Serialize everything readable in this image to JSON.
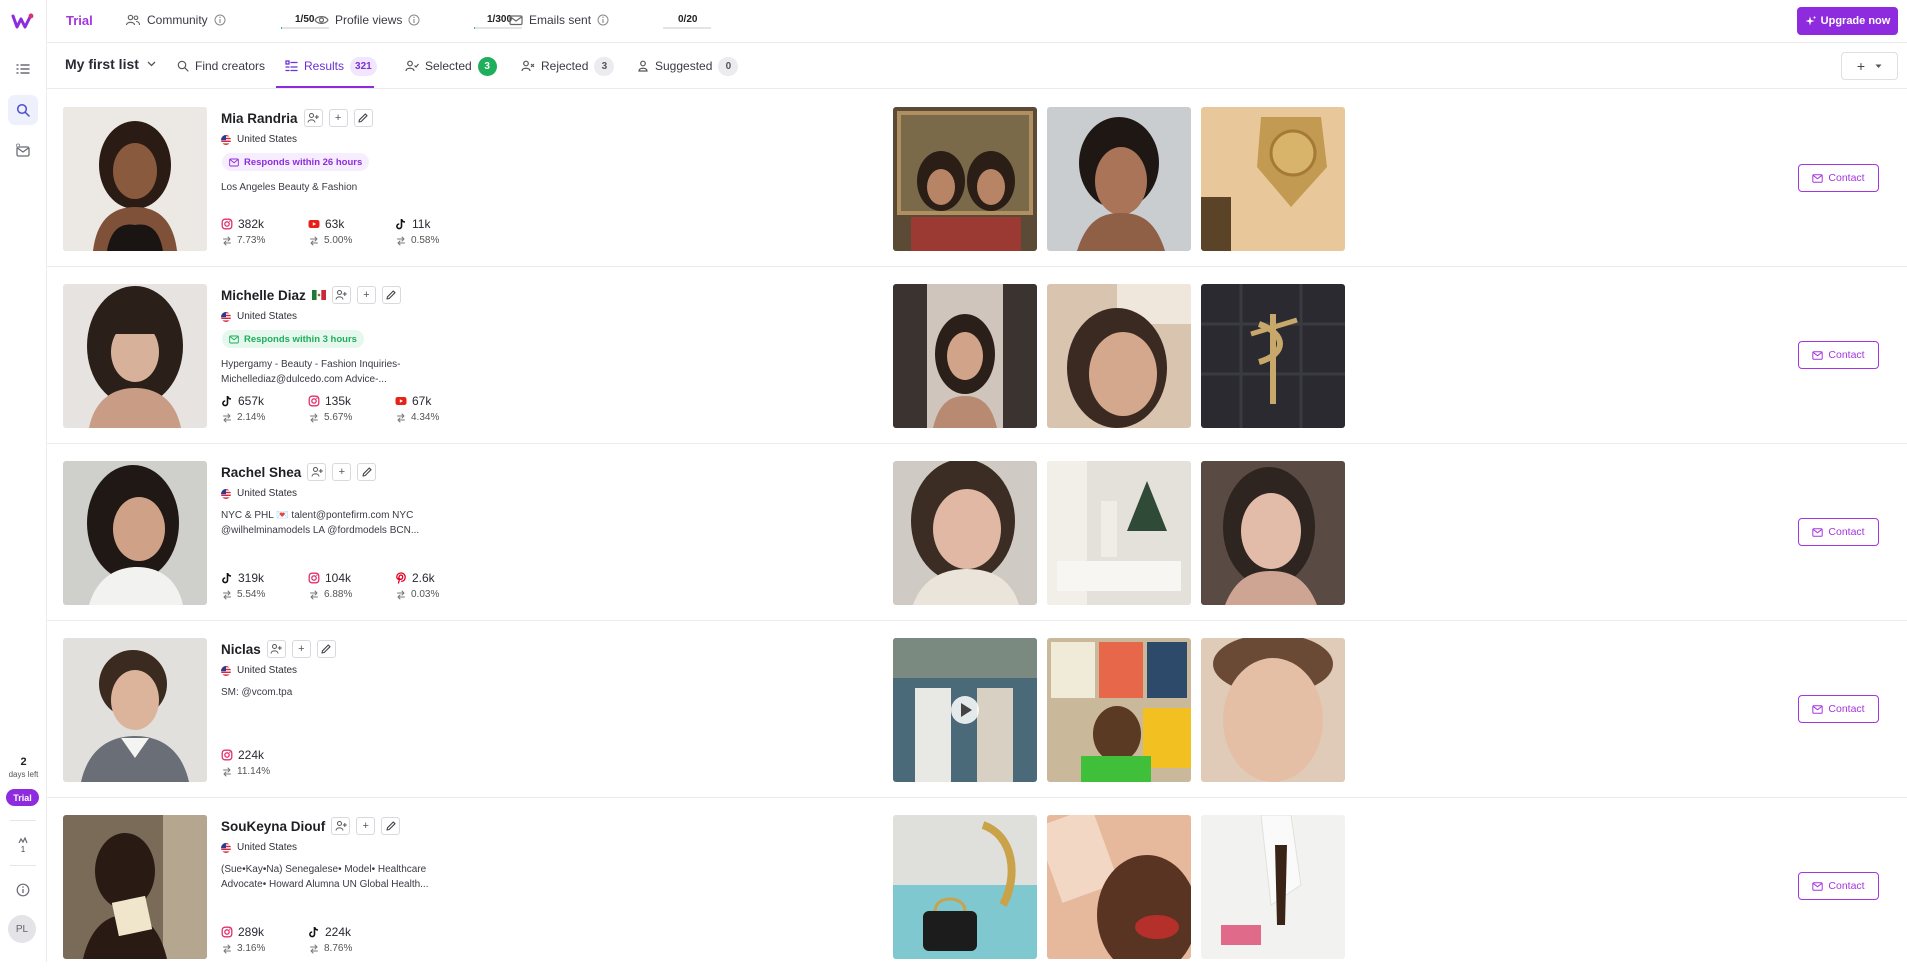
{
  "topbar": {
    "trial_label": "Trial",
    "quotas": [
      {
        "label": "Community",
        "value": "1/50",
        "used": 1,
        "total": 50
      },
      {
        "label": "Profile views",
        "value": "1/300",
        "used": 1,
        "total": 300
      },
      {
        "label": "Emails sent",
        "value": "0/20",
        "used": 0,
        "total": 20
      }
    ],
    "upgrade_label": "Upgrade now"
  },
  "sidebar": {
    "days_left_value": "2",
    "days_left_label": "days left",
    "trial_badge": "Trial",
    "counter_value": "1",
    "avatar_initials": "PL"
  },
  "tabsbar": {
    "list_name": "My first list",
    "tabs": [
      {
        "label": "Find creators",
        "count": ""
      },
      {
        "label": "Results",
        "count": "321"
      },
      {
        "label": "Selected",
        "count": "3"
      },
      {
        "label": "Rejected",
        "count": "3"
      },
      {
        "label": "Suggested",
        "count": "0"
      }
    ],
    "plus": "+"
  },
  "creators": [
    {
      "name": "Mia Randria",
      "name_flag": "",
      "country": "United States",
      "responds": "Responds within 26 hours",
      "responds_color": "purple",
      "bio_line1": "Los Angeles Beauty & Fashion",
      "bio_line2": "",
      "stats": [
        {
          "platform": "instagram-icon",
          "followers": "382k",
          "engagement": "7.73%"
        },
        {
          "platform": "youtube-icon",
          "followers": "63k",
          "engagement": "5.00%"
        },
        {
          "platform": "tiktok-icon",
          "followers": "11k",
          "engagement": "0.58%"
        }
      ],
      "contact_label": "Contact"
    },
    {
      "name": "Michelle Diaz",
      "name_flag": "mexico-flag-icon",
      "country": "United States",
      "responds": "Responds within 3 hours",
      "responds_color": "green",
      "bio_line1": "Hypergamy - Beauty - Fashion Inquiries-",
      "bio_line2": "Michellediaz@dulcedo.com Advice-...",
      "stats": [
        {
          "platform": "tiktok-icon",
          "followers": "657k",
          "engagement": "2.14%"
        },
        {
          "platform": "instagram-icon",
          "followers": "135k",
          "engagement": "5.67%"
        },
        {
          "platform": "youtube-icon",
          "followers": "67k",
          "engagement": "4.34%"
        }
      ],
      "contact_label": "Contact"
    },
    {
      "name": "Rachel Shea",
      "name_flag": "",
      "country": "United States",
      "responds": "",
      "responds_color": "",
      "bio_line1": "NYC & PHL 💌 talent@pontefirm.com NYC",
      "bio_line2": "@wilhelminamodels LA @fordmodels BCN...",
      "stats": [
        {
          "platform": "tiktok-icon",
          "followers": "319k",
          "engagement": "5.54%"
        },
        {
          "platform": "instagram-icon",
          "followers": "104k",
          "engagement": "6.88%"
        },
        {
          "platform": "pinterest-icon",
          "followers": "2.6k",
          "engagement": "0.03%"
        }
      ],
      "contact_label": "Contact"
    },
    {
      "name": "Niclas",
      "name_flag": "",
      "country": "United States",
      "responds": "",
      "responds_color": "",
      "bio_line1": "SM: @vcom.tpa",
      "bio_line2": "",
      "stats": [
        {
          "platform": "instagram-icon",
          "followers": "224k",
          "engagement": "11.14%"
        }
      ],
      "contact_label": "Contact"
    },
    {
      "name": "SouKeyna Diouf",
      "name_flag": "",
      "country": "United States",
      "responds": "",
      "responds_color": "",
      "bio_line1": "(Sue•Kay•Na) Senegalese• Model• Healthcare",
      "bio_line2": "Advocate• Howard Alumna UN Global Health...",
      "stats": [
        {
          "platform": "instagram-icon",
          "followers": "289k",
          "engagement": "3.16%"
        },
        {
          "platform": "tiktok-icon",
          "followers": "224k",
          "engagement": "8.76%"
        }
      ],
      "contact_label": "Contact"
    }
  ],
  "colors": {
    "accent": "#8f2bde",
    "green": "#1fae5b",
    "instagram": "#e1306c",
    "youtube": "#e62117",
    "pinterest": "#e60023"
  }
}
